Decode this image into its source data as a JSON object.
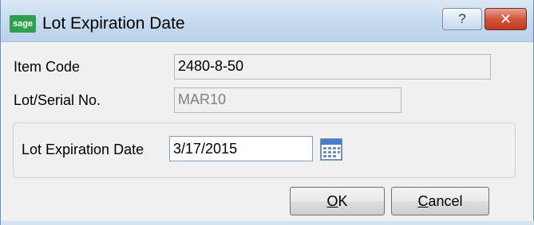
{
  "window": {
    "title": "Lot Expiration Date",
    "logo_text": "sage",
    "help_symbol": "?",
    "close_symbol": "✕"
  },
  "fields": {
    "item_code": {
      "label": "Item Code",
      "value": "2480-8-50"
    },
    "lot_serial": {
      "label": "Lot/Serial No.",
      "value": "MAR10"
    },
    "expiration": {
      "label": "Lot Expiration Date",
      "value": "3/17/2015"
    }
  },
  "buttons": {
    "ok": {
      "mnemonic": "O",
      "rest": "K"
    },
    "cancel": {
      "mnemonic": "C",
      "rest": "ancel"
    }
  },
  "icons": {
    "app_logo": "sage-logo-icon",
    "help": "help-icon",
    "close": "close-icon",
    "calendar": "calendar-icon"
  },
  "colors": {
    "logo_green": "#2f9e4e",
    "close_red": "#c23a22",
    "titlebar_blue": "#c9dcf0"
  }
}
